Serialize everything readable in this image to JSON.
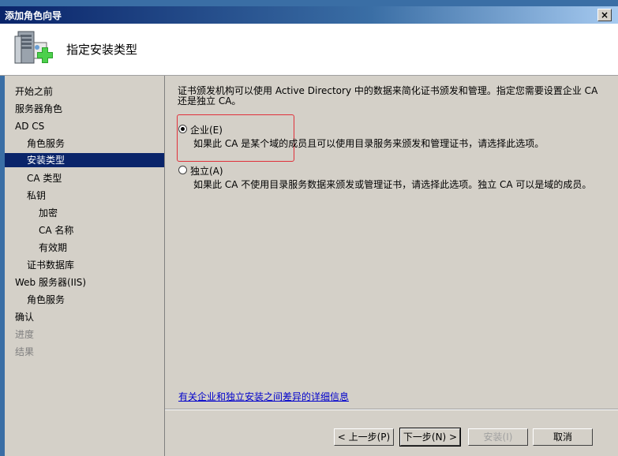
{
  "window": {
    "title": "添加角色向导",
    "close_label": "×"
  },
  "header": {
    "title": "指定安装类型",
    "icon": "server-roles-add-icon"
  },
  "sidebar": {
    "items": [
      {
        "label": "开始之前",
        "indent": 0,
        "state": "normal"
      },
      {
        "label": "服务器角色",
        "indent": 0,
        "state": "normal"
      },
      {
        "label": "AD CS",
        "indent": 0,
        "state": "normal"
      },
      {
        "label": "角色服务",
        "indent": 1,
        "state": "normal"
      },
      {
        "label": "安装类型",
        "indent": 1,
        "state": "selected"
      },
      {
        "label": "CA 类型",
        "indent": 1,
        "state": "normal"
      },
      {
        "label": "私钥",
        "indent": 1,
        "state": "normal"
      },
      {
        "label": "加密",
        "indent": 2,
        "state": "normal"
      },
      {
        "label": "CA 名称",
        "indent": 2,
        "state": "normal"
      },
      {
        "label": "有效期",
        "indent": 2,
        "state": "normal"
      },
      {
        "label": "证书数据库",
        "indent": 1,
        "state": "normal"
      },
      {
        "label": "Web 服务器(IIS)",
        "indent": 0,
        "state": "normal"
      },
      {
        "label": "角色服务",
        "indent": 1,
        "state": "normal"
      },
      {
        "label": "确认",
        "indent": 0,
        "state": "normal"
      },
      {
        "label": "进度",
        "indent": 0,
        "state": "disabled"
      },
      {
        "label": "结果",
        "indent": 0,
        "state": "disabled"
      }
    ]
  },
  "content": {
    "description": "证书颁发机构可以使用 Active Directory 中的数据来简化证书颁发和管理。指定您需要设置企业 CA 还是独立 CA。",
    "options": [
      {
        "label": "企业(E)",
        "description": "如果此 CA 是某个域的成员且可以使用目录服务来颁发和管理证书，请选择此选项。",
        "checked": true
      },
      {
        "label": "独立(A)",
        "description": "如果此 CA 不使用目录服务数据来颁发或管理证书，请选择此选项。独立 CA 可以是域的成员。",
        "checked": false
      }
    ],
    "more_info_link": "有关企业和独立安装之间差异的详细信息"
  },
  "buttons": {
    "back": "< 上一步(P)",
    "next": "下一步(N) >",
    "install": "安装(I)",
    "cancel": "取消"
  },
  "colors": {
    "selected_bg": "#0a246a",
    "link": "#0000cc",
    "highlight_box": "#e0303a"
  }
}
